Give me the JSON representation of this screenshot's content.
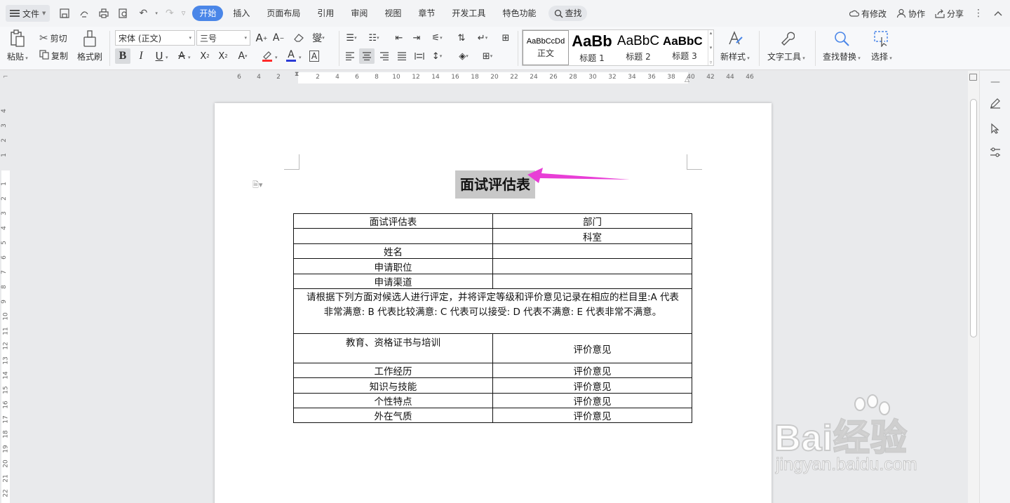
{
  "menubar": {
    "file_label": "文件",
    "tabs": [
      "开始",
      "插入",
      "页面布局",
      "引用",
      "审阅",
      "视图",
      "章节",
      "开发工具",
      "特色功能"
    ],
    "search_label": "查找",
    "right": {
      "modify": "有修改",
      "collab": "协作",
      "share": "分享"
    }
  },
  "ribbon": {
    "paste": "粘贴",
    "cut": "剪切",
    "copy": "复制",
    "format_painter": "格式刷",
    "font_name": "宋体 (正文)",
    "font_size": "三号",
    "styles": [
      {
        "preview": "AaBbCcDd",
        "name": "正文"
      },
      {
        "preview": "AaBb",
        "name": "标题 1"
      },
      {
        "preview": "AaBbC",
        "name": "标题 2"
      },
      {
        "preview": "AaBbC",
        "name": "标题 3"
      }
    ],
    "new_style": "新样式",
    "text_tools": "文字工具",
    "find_replace": "查找替换",
    "select": "选择"
  },
  "ruler": {
    "h_ticks": [
      "6",
      "4",
      "2",
      "2",
      "4",
      "6",
      "8",
      "10",
      "12",
      "14",
      "16",
      "18",
      "20",
      "22",
      "24",
      "26",
      "28",
      "30",
      "32",
      "34",
      "36",
      "38",
      "40",
      "42",
      "44",
      "46"
    ],
    "v_ticks": [
      "4",
      "3",
      "2",
      "1",
      "1",
      "2",
      "3",
      "4",
      "5",
      "6",
      "7",
      "8",
      "9",
      "10",
      "11",
      "12",
      "13",
      "14",
      "15",
      "16",
      "17",
      "18",
      "19",
      "20",
      "21",
      "22"
    ]
  },
  "document": {
    "title": "面试评估表",
    "table": {
      "row1": [
        "面试评估表",
        "部门"
      ],
      "row2": [
        "",
        "科室"
      ],
      "row3": [
        "姓名",
        ""
      ],
      "row4": [
        "申请职位",
        ""
      ],
      "row5": [
        "申请渠道",
        ""
      ],
      "instructions_line1": "请根据下列方面对候选人进行评定，并将评定等级和评价意见记录在相应的栏目里:A 代表",
      "instructions_line2": "非常满意: B 代表比较满意: C 代表可以接受: D 代表不满意: E 代表非常不满意。",
      "eval_rows": [
        {
          "item": "教育、资格证书与培训",
          "comment": "评价意见"
        },
        {
          "item": "工作经历",
          "comment": "评价意见"
        },
        {
          "item": "知识与技能",
          "comment": "评价意见"
        },
        {
          "item": "个性特点",
          "comment": "评价意见"
        },
        {
          "item": "外在气质",
          "comment": "评价意见"
        }
      ]
    }
  },
  "watermark": {
    "main": "Bai经验",
    "sub": "jingyan.baidu.com"
  },
  "colors": {
    "accent": "#4a86e8",
    "arrow": "#e83ed6",
    "title_highlight": "#c8c8c8"
  }
}
